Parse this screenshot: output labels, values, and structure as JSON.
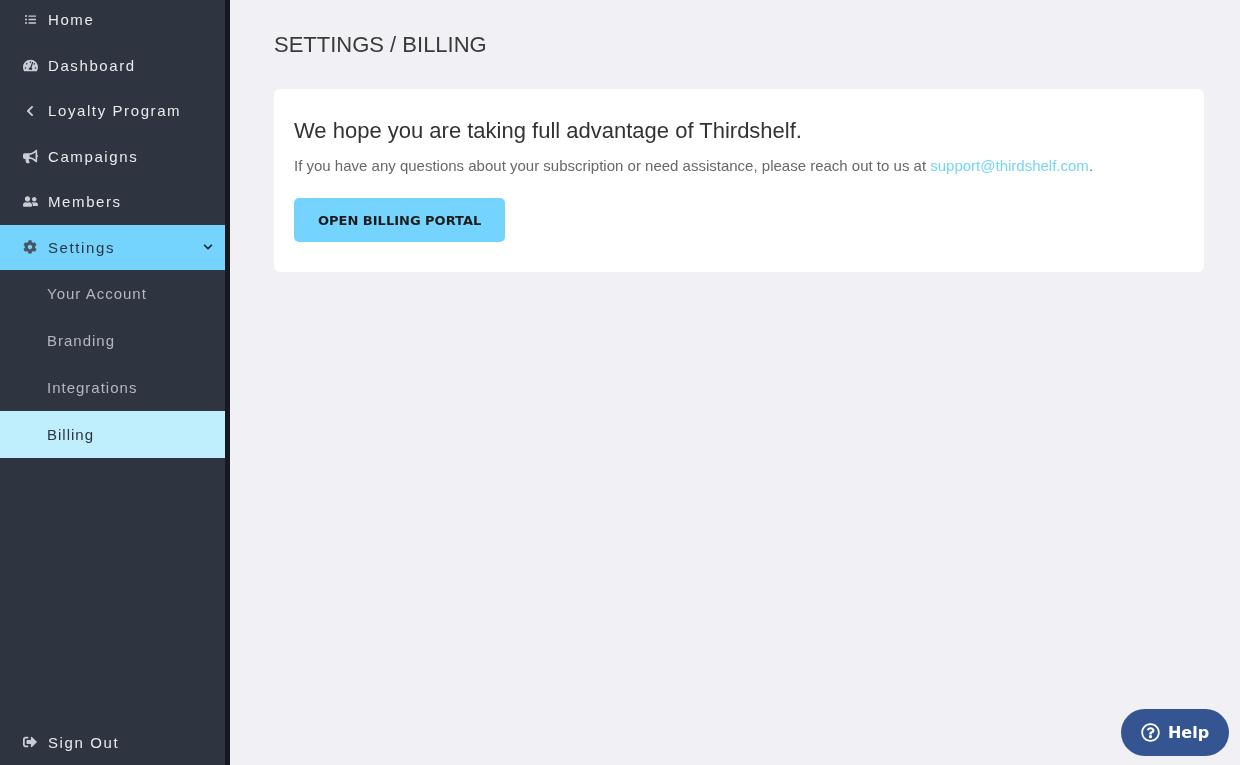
{
  "sidebar": {
    "items": [
      {
        "label": "Home",
        "selected": false
      },
      {
        "label": "Dashboard",
        "selected": false
      },
      {
        "label": "Loyalty Program",
        "selected": false
      },
      {
        "label": "Campaigns",
        "selected": false
      },
      {
        "label": "Members",
        "selected": false
      },
      {
        "label": "Settings",
        "selected": true,
        "expanded": true,
        "children": [
          {
            "label": "Your Account",
            "selected": false
          },
          {
            "label": "Branding",
            "selected": false
          },
          {
            "label": "Integrations",
            "selected": false
          },
          {
            "label": "Billing",
            "selected": true
          }
        ]
      }
    ],
    "sign_out": {
      "label": "Sign Out"
    }
  },
  "main": {
    "page_title": "SETTINGS / BILLING",
    "card": {
      "heading": "We hope you are taking full advantage of Thirdshelf.",
      "message": {
        "text": "If you have any questions about your subscription or need assistance, please reach out to us at ",
        "link": "support@thirdshelf.com",
        "end": "."
      },
      "button": "OPEN BILLING PORTAL"
    }
  },
  "help_button": {
    "label": "Help"
  }
}
